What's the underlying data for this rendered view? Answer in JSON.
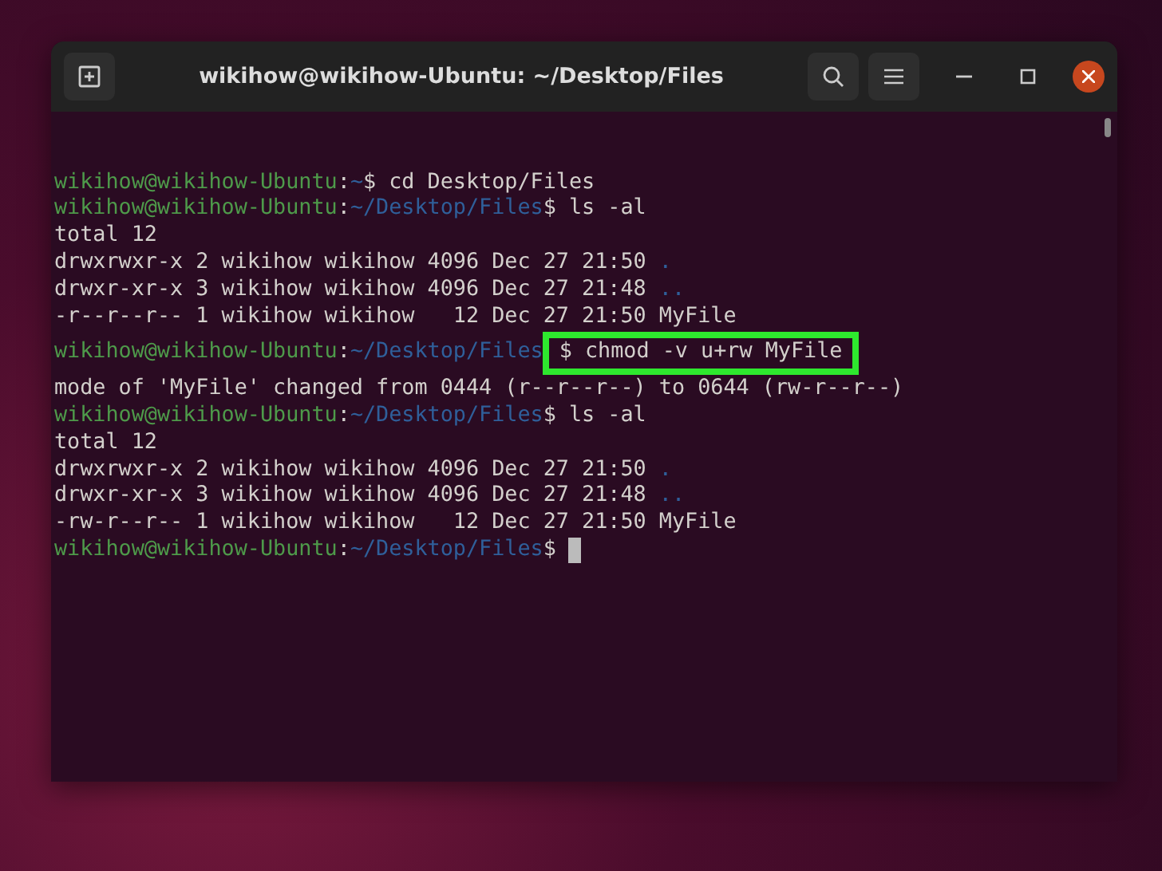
{
  "window": {
    "title": "wikihow@wikihow-Ubuntu: ~/Desktop/Files"
  },
  "lines": [
    {
      "kind": "prompt",
      "user": "wikihow@wikihow-Ubuntu",
      "sep": ":",
      "path": "~",
      "sigil": "$",
      "command": "cd Desktop/Files",
      "highlighted": false,
      "cursor": false
    },
    {
      "kind": "prompt",
      "user": "wikihow@wikihow-Ubuntu",
      "sep": ":",
      "path": "~/Desktop/Files",
      "sigil": "$",
      "command": "ls -al",
      "highlighted": false,
      "cursor": false
    },
    {
      "kind": "output",
      "text": "total 12"
    },
    {
      "kind": "listing",
      "text": "drwxrwxr-x 2 wikihow wikihow 4096 Dec 27 21:50",
      "entry": ".",
      "color": "#2f5f9a"
    },
    {
      "kind": "listing",
      "text": "drwxr-xr-x 3 wikihow wikihow 4096 Dec 27 21:48",
      "entry": "..",
      "color": "#2f5f9a"
    },
    {
      "kind": "listing",
      "text": "-r--r--r-- 1 wikihow wikihow   12 Dec 27 21:50",
      "entry": "MyFile",
      "color": "#d3d0cc"
    },
    {
      "kind": "prompt",
      "user": "wikihow@wikihow-Ubuntu",
      "sep": ":",
      "path": "~/Desktop/Files",
      "sigil": "$",
      "command": "chmod -v u+rw MyFile",
      "highlighted": true,
      "cursor": false
    },
    {
      "kind": "output",
      "text": "mode of 'MyFile' changed from 0444 (r--r--r--) to 0644 (rw-r--r--)"
    },
    {
      "kind": "prompt",
      "user": "wikihow@wikihow-Ubuntu",
      "sep": ":",
      "path": "~/Desktop/Files",
      "sigil": "$",
      "command": "ls -al",
      "highlighted": false,
      "cursor": false
    },
    {
      "kind": "output",
      "text": "total 12"
    },
    {
      "kind": "listing",
      "text": "drwxrwxr-x 2 wikihow wikihow 4096 Dec 27 21:50",
      "entry": ".",
      "color": "#2f5f9a"
    },
    {
      "kind": "listing",
      "text": "drwxr-xr-x 3 wikihow wikihow 4096 Dec 27 21:48",
      "entry": "..",
      "color": "#2f5f9a"
    },
    {
      "kind": "listing",
      "text": "-rw-r--r-- 1 wikihow wikihow   12 Dec 27 21:50",
      "entry": "MyFile",
      "color": "#d3d0cc"
    },
    {
      "kind": "prompt",
      "user": "wikihow@wikihow-Ubuntu",
      "sep": ":",
      "path": "~/Desktop/Files",
      "sigil": "$",
      "highlighted": false,
      "cursor": true
    }
  ]
}
